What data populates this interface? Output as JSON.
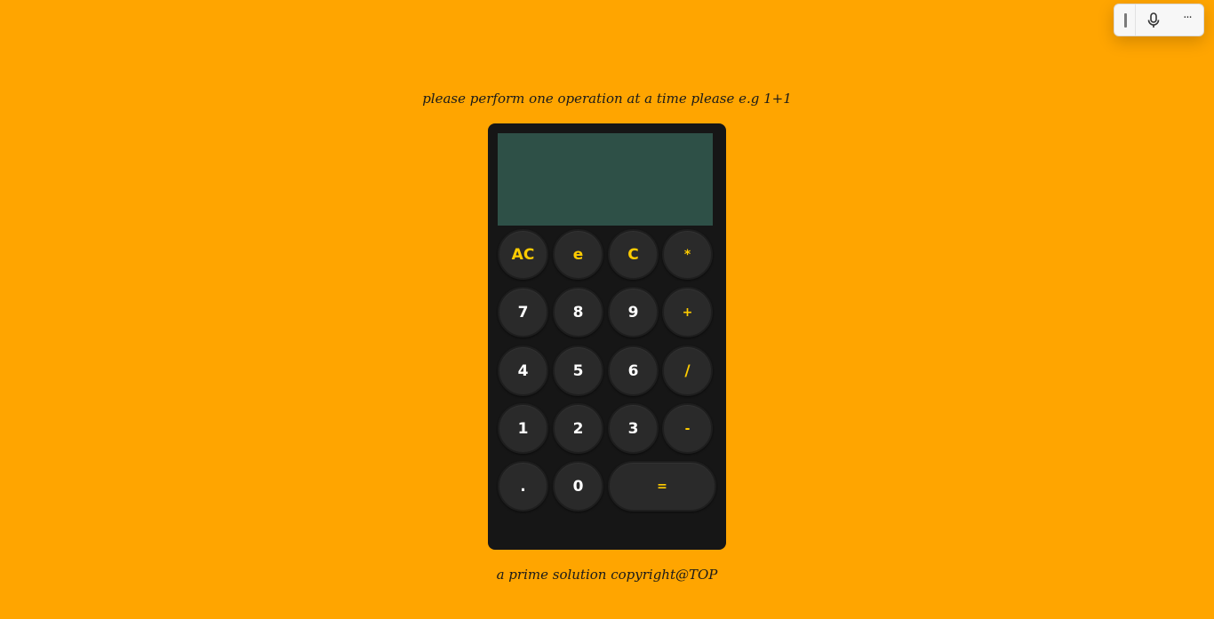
{
  "instruction": "please perform one operation at a time please e.g 1+1",
  "footer": "a prime solution copyright@TOP",
  "display": {
    "value": ""
  },
  "keys": {
    "ac": "AC",
    "e": "e",
    "c": "C",
    "multiply": "*",
    "seven": "7",
    "eight": "8",
    "nine": "9",
    "plus": "+",
    "four": "4",
    "five": "5",
    "six": "6",
    "divide": "/",
    "one": "1",
    "two": "2",
    "three": "3",
    "minus": "-",
    "dot": ".",
    "zero": "0",
    "equals": "="
  },
  "toolbar": {
    "mic_icon": "microphone-icon",
    "more": "···"
  },
  "colors": {
    "background": "#ffa500",
    "calculator_body": "#161616",
    "display": "#2e5047",
    "key": "#2a2a2a",
    "operator_text": "#ffcc00",
    "digit_text": "#ffffff"
  }
}
